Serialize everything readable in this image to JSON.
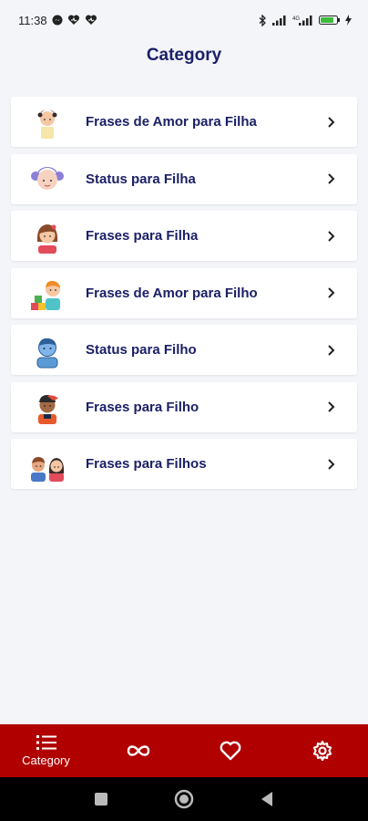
{
  "status_bar": {
    "time": "11:38",
    "battery_level": "84"
  },
  "page": {
    "title": "Category"
  },
  "categories": [
    {
      "label": "Frases de Amor para Filha",
      "icon": "girl-baby-avatar-icon"
    },
    {
      "label": "Status para Filha",
      "icon": "girl-pigtails-avatar-icon"
    },
    {
      "label": "Frases para Filha",
      "icon": "girl-avatar-icon"
    },
    {
      "label": "Frases de Amor para Filho",
      "icon": "boy-with-blocks-avatar-icon"
    },
    {
      "label": "Status para Filho",
      "icon": "boy-blue-avatar-icon"
    },
    {
      "label": "Frases para Filho",
      "icon": "boy-cap-avatar-icon"
    },
    {
      "label": "Frases para Filhos",
      "icon": "boy-and-girl-avatar-icon"
    }
  ],
  "bottom_nav": [
    {
      "label": "Category",
      "icon": "list-icon",
      "active": true
    },
    {
      "label": "",
      "icon": "infinity-icon"
    },
    {
      "label": "",
      "icon": "heart-icon"
    },
    {
      "label": "",
      "icon": "settings-icon"
    }
  ],
  "colors": {
    "accent": "#b00000",
    "title": "#1b2066",
    "background": "#f3f5f9"
  }
}
